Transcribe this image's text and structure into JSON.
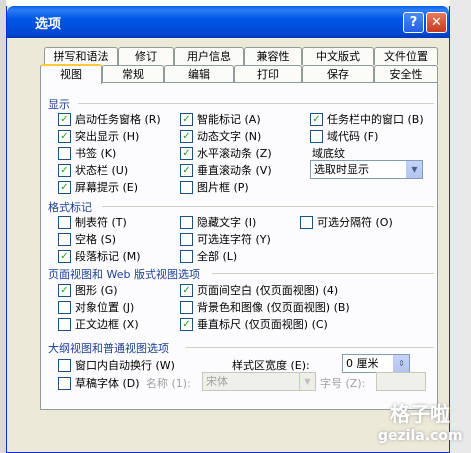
{
  "window": {
    "title": "选项",
    "help_glyph": "?",
    "close_glyph": "✕"
  },
  "tabs_row1": [
    "拼写和语法",
    "修订",
    "用户信息",
    "兼容性",
    "中文版式",
    "文件位置"
  ],
  "tabs_row2": [
    "视图",
    "常规",
    "编辑",
    "打印",
    "保存",
    "安全性"
  ],
  "active_tab": "视图",
  "display": {
    "heading": "显示",
    "items": [
      {
        "label": "启动任务窗格 (R)",
        "checked": true
      },
      {
        "label": "智能标记 (A)",
        "checked": true
      },
      {
        "label": "任务栏中的窗口 (B)",
        "checked": true
      },
      {
        "label": "突出显示 (H)",
        "checked": true
      },
      {
        "label": "动态文字 (N)",
        "checked": true
      },
      {
        "label": "域代码 (F)",
        "checked": false
      },
      {
        "label": "书签 (K)",
        "checked": false
      },
      {
        "label": "水平滚动条 (Z)",
        "checked": true
      },
      {
        "label": "状态栏 (U)",
        "checked": true
      },
      {
        "label": "垂直滚动条 (V)",
        "checked": true
      },
      {
        "label": "屏幕提示 (E)",
        "checked": true
      },
      {
        "label": "图片框 (P)",
        "checked": false
      }
    ],
    "field_shading_label": "域底纹",
    "field_shading_value": "选取时显示"
  },
  "format_marks": {
    "heading": "格式标记",
    "items": [
      {
        "label": "制表符 (T)",
        "checked": false
      },
      {
        "label": "隐藏文字 (I)",
        "checked": false
      },
      {
        "label": "可选分隔符 (O)",
        "checked": false
      },
      {
        "label": "空格 (S)",
        "checked": false
      },
      {
        "label": "可选连字符 (Y)",
        "checked": false
      },
      {
        "label": "段落标记 (M)",
        "checked": true
      },
      {
        "label": "全部 (L)",
        "checked": false
      }
    ]
  },
  "print_web": {
    "heading": "页面视图和 Web 版式视图选项",
    "items": [
      {
        "label": "图形 (G)",
        "checked": true
      },
      {
        "label": "页面间空白 (仅页面视图) (4)",
        "checked": true
      },
      {
        "label": "对象位置 (J)",
        "checked": false
      },
      {
        "label": "背景色和图像 (仅页面视图) (B)",
        "checked": false
      },
      {
        "label": "正文边框 (X)",
        "checked": false
      },
      {
        "label": "垂直标尺 (仅页面视图) (C)",
        "checked": true
      }
    ]
  },
  "outline": {
    "heading": "大纲视图和普通视图选项",
    "wrap_label": "窗口内自动换行 (W)",
    "wrap_checked": false,
    "style_width_label": "样式区宽度 (E):",
    "style_width_value": "0 厘米",
    "draft_label": "草稿字体 (D)",
    "draft_checked": false,
    "name_label": "名称 (1):",
    "name_value": "宋体",
    "size_label": "字号 (Z):"
  },
  "watermark": {
    "line1": "格子啦",
    "line2": "gezila.com"
  },
  "colors": {
    "title_bar": "#0054e3",
    "dialog_bg": "#ece9d8",
    "check": "#21a121",
    "section_text": "#1b3f95"
  }
}
